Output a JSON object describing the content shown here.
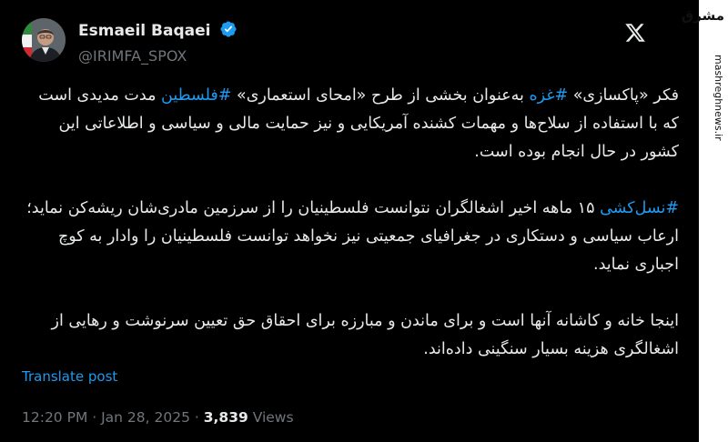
{
  "author": {
    "display_name": "Esmaeil Baqaei",
    "handle": "@IRIMFA_SPOX"
  },
  "post": {
    "p1_pre": "فکر «پاکسازی» ",
    "p1_tag1": "#غزه",
    "p1_mid": " به‌عنوان بخشی از طرح «امحای استعماری» ",
    "p1_tag2": "#فلسطین",
    "p1_post": " مدت مدیدی است که با استفاده از سلاح‌ها و مهمات کشنده آمریکایی و نیز حمایت مالی و سیاسی و اطلاعاتی این کشور در حال انجام بوده است.",
    "p2_tag": "#نسل‌کشی",
    "p2_post": " ۱۵ ماهه اخیر اشغالگران نتوانست فلسطینیان را از سرزمین مادری‌شان ریشه‌کن نماید؛ ارعاب سیاسی و دستکاری در جغرافیای جمعیتی نیز نخواهد توانست فلسطینیان را وادار به کوچ اجباری نماید.",
    "p3": "اینجا خانه و کاشانه آنها است و برای ماندن و مبارزه برای احقاق حق تعیین سرنوشت و رهایی از اشغالگری هزینه بسیار سنگینی داده‌اند."
  },
  "translate_label": "Translate post",
  "meta": {
    "time": "12:20 PM",
    "sep1": " · ",
    "date": "Jan 28, 2025",
    "sep2": " · ",
    "views_count": "3,839",
    "views_label": " Views"
  },
  "watermark": {
    "logo": "مشرق",
    "url": "mashreghnews.ir"
  },
  "colors": {
    "background": "#000000",
    "text": "#e7e9ea",
    "secondary": "#71767b",
    "link": "#1d9bf0",
    "verified": "#1d9bf0"
  },
  "icons": [
    "verified-badge-icon",
    "x-logo-icon"
  ]
}
